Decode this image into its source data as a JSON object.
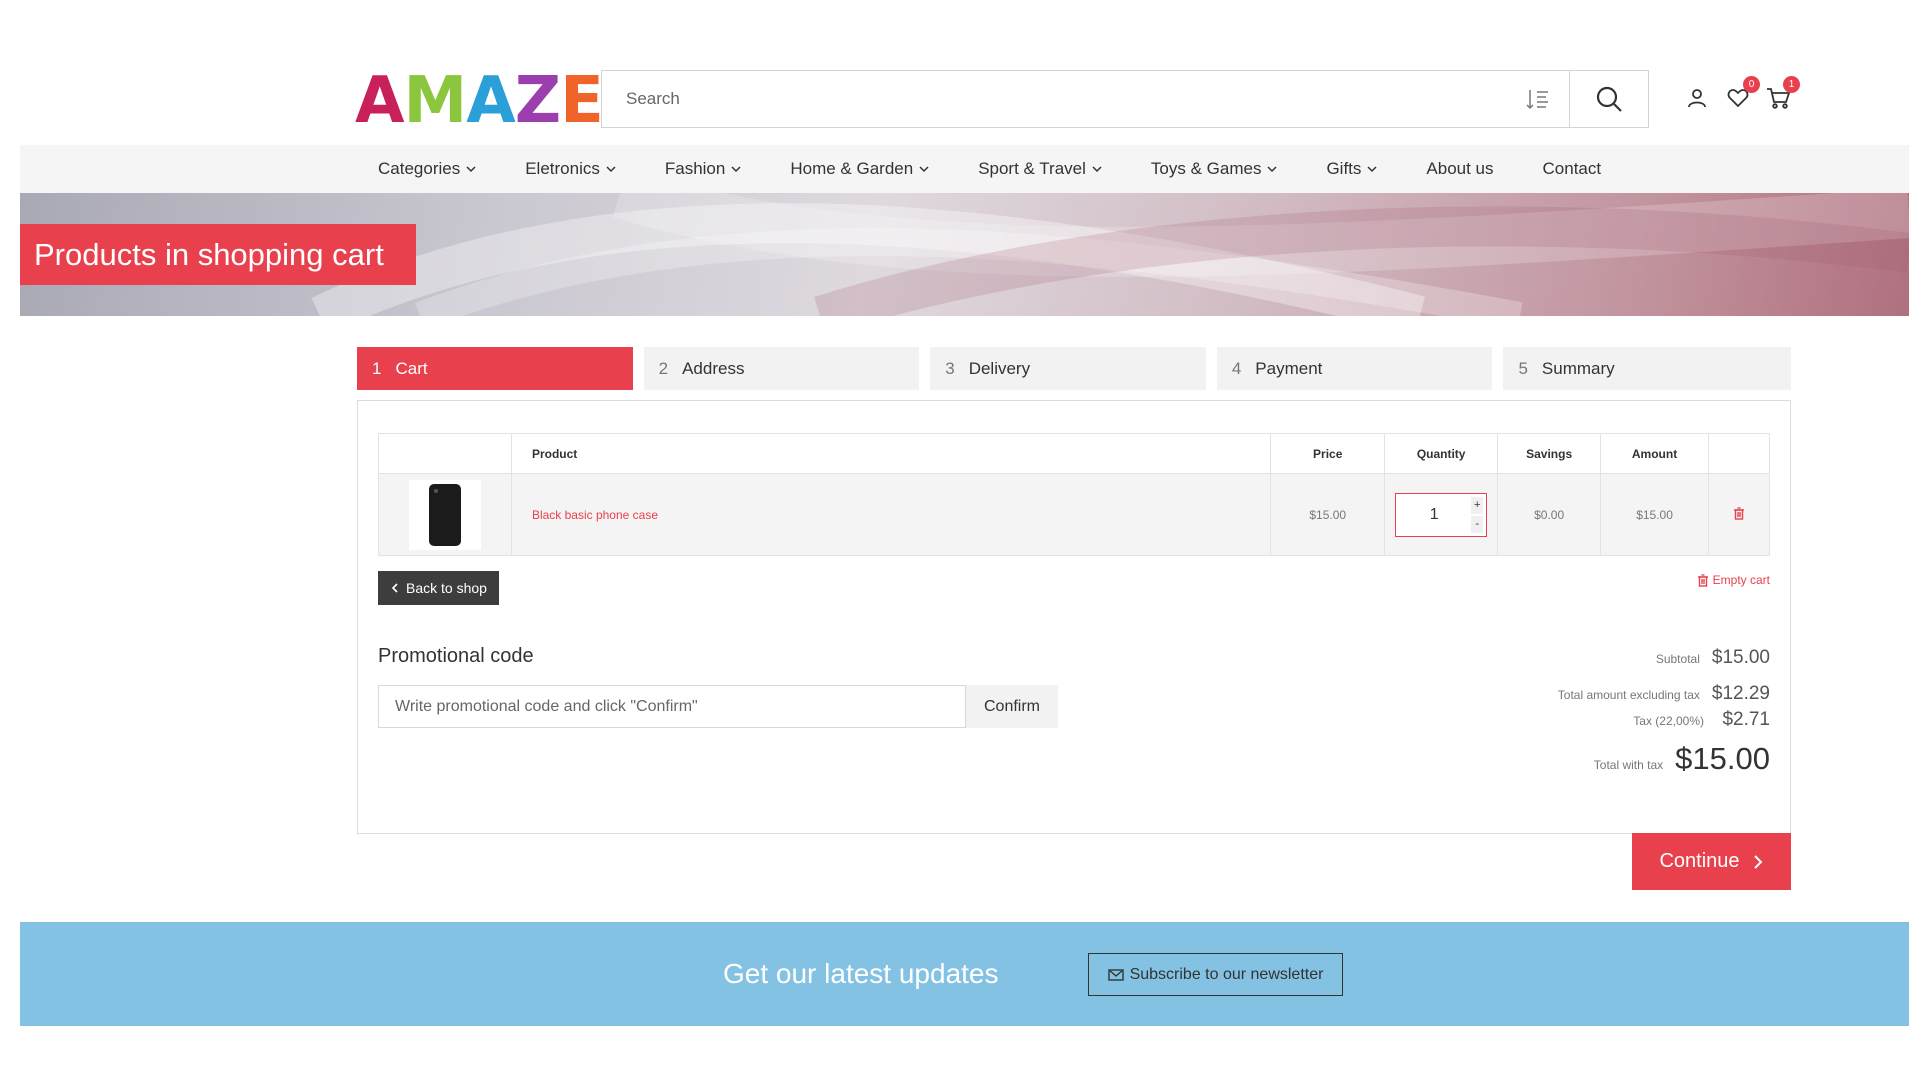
{
  "header": {
    "logo_letters": [
      {
        "char": "A",
        "color": "#c8205a"
      },
      {
        "char": "M",
        "color": "#8cc63f"
      },
      {
        "char": "A",
        "color": "#2a9fd8"
      },
      {
        "char": "Z",
        "color": "#9b3fae"
      },
      {
        "char": "E",
        "color": "#f0642b"
      }
    ],
    "search_placeholder": "Search",
    "icons": {
      "filter": "list-filter-icon",
      "search": "search-icon",
      "account": "user-icon",
      "wishlist": "heart-icon",
      "cart": "cart-icon"
    },
    "wishlist_count": "0",
    "cart_count": "1"
  },
  "nav": {
    "items": [
      {
        "label": "Categories",
        "dropdown": true
      },
      {
        "label": "Eletronics",
        "dropdown": true
      },
      {
        "label": "Fashion",
        "dropdown": true
      },
      {
        "label": "Home & Garden",
        "dropdown": true
      },
      {
        "label": "Sport & Travel",
        "dropdown": true
      },
      {
        "label": "Toys & Games",
        "dropdown": true
      },
      {
        "label": "Gifts",
        "dropdown": true
      },
      {
        "label": "About us",
        "dropdown": false
      },
      {
        "label": "Contact",
        "dropdown": false
      }
    ]
  },
  "banner": {
    "title": "Products in shopping cart"
  },
  "steps": [
    {
      "num": "1",
      "label": "Cart",
      "active": true
    },
    {
      "num": "2",
      "label": "Address",
      "active": false
    },
    {
      "num": "3",
      "label": "Delivery",
      "active": false
    },
    {
      "num": "4",
      "label": "Payment",
      "active": false
    },
    {
      "num": "5",
      "label": "Summary",
      "active": false
    }
  ],
  "cart": {
    "columns": {
      "product": "Product",
      "price": "Price",
      "quantity": "Quantity",
      "savings": "Savings",
      "amount": "Amount"
    },
    "rows": [
      {
        "product": "Black basic phone case",
        "price": "$15.00",
        "quantity": "1",
        "savings": "$0.00",
        "amount": "$15.00"
      }
    ],
    "back_label": "Back to shop",
    "empty_label": "Empty cart"
  },
  "promo": {
    "title": "Promotional code",
    "placeholder": "Write promotional code and click \"Confirm\"",
    "confirm_label": "Confirm"
  },
  "totals": {
    "subtotal_label": "Subtotal",
    "subtotal": "$15.00",
    "excl_tax_label": "Total amount excluding tax",
    "excl_tax": "$12.29",
    "tax_label": "Tax (22,00%)",
    "tax": "$2.71",
    "total_label": "Total with tax",
    "total": "$15.00"
  },
  "continue_label": "Continue",
  "newsletter": {
    "title": "Get our latest updates",
    "button_label": "Subscribe to our newsletter"
  },
  "colors": {
    "accent": "#e8414d",
    "newsletter_bg": "#84c2e4",
    "dark_button": "#3d3d3d"
  }
}
